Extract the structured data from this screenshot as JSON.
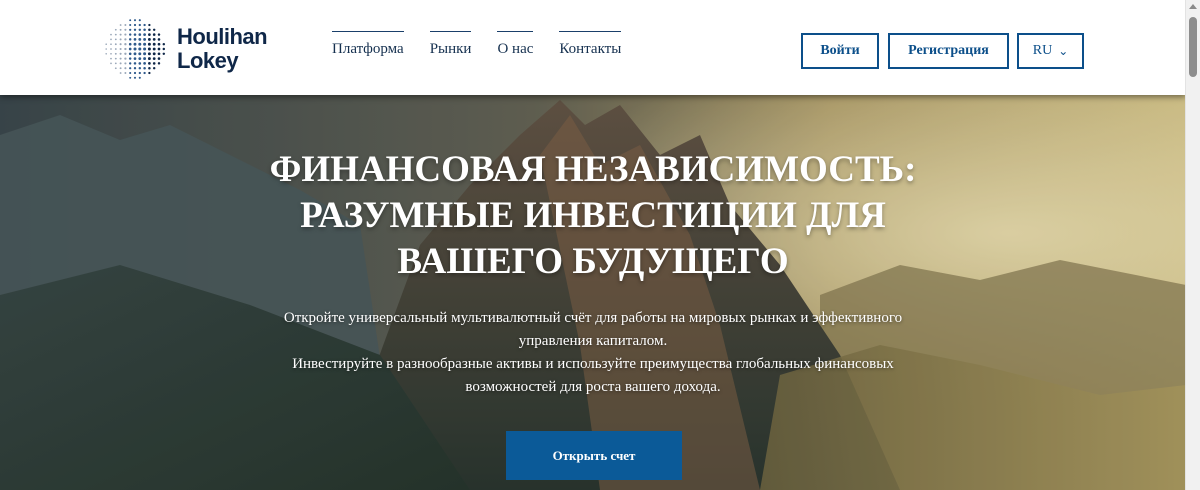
{
  "brand": {
    "name_line1": "Houlihan",
    "name_line2": "Lokey",
    "logo_icon": "dotted-globe-icon"
  },
  "nav": {
    "items": [
      {
        "label": "Платформа"
      },
      {
        "label": "Рынки"
      },
      {
        "label": "О нас"
      },
      {
        "label": "Контакты"
      }
    ]
  },
  "header_actions": {
    "login_label": "Войти",
    "register_label": "Регистрация",
    "language": "RU",
    "language_icon": "chevron-down-icon"
  },
  "hero": {
    "title_lines": [
      "ФИНАНСОВАЯ НЕЗАВИСИМОСТЬ:",
      "РАЗУМНЫЕ ИНВЕСТИЦИИ ДЛЯ",
      "ВАШЕГО БУДУЩЕГО"
    ],
    "text_lines": [
      "Откройте универсальный мультивалютный счёт для работы на мировых рынках и эффективного",
      "управления капиталом.",
      "Инвестируйте в разнообразные активы и используйте преимущества глобальных финансовых",
      "возможностей для роста вашего дохода."
    ],
    "cta_label": "Открыть счет"
  },
  "colors": {
    "brand_navy": "#0f2748",
    "accent_blue": "#0c4f8a",
    "cta_blue": "#0b5a98"
  }
}
